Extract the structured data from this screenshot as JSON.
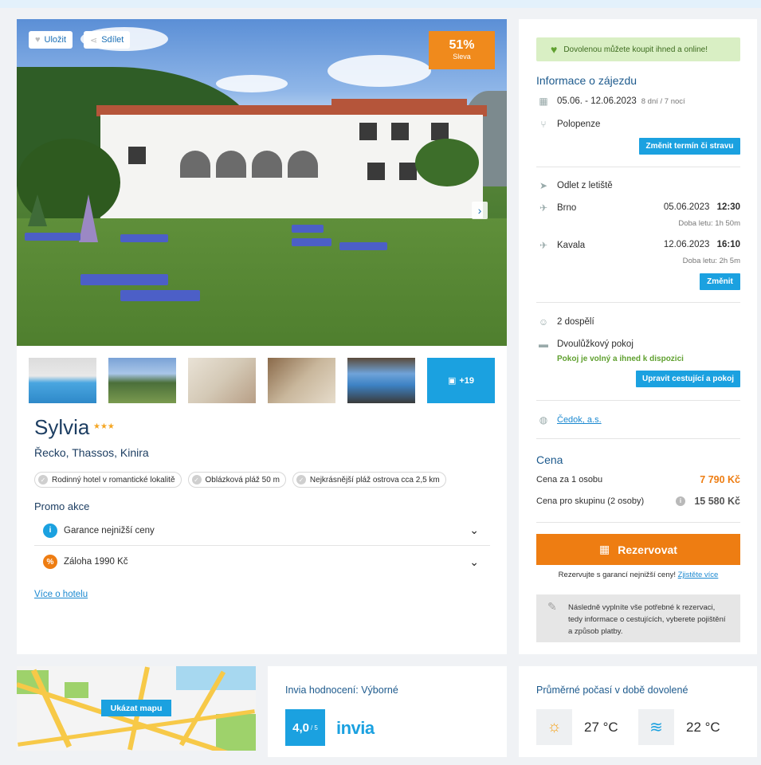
{
  "photo": {
    "save_label": "Uložit",
    "share_label": "Sdílet",
    "discount_pct": "51%",
    "discount_label": "Sleva",
    "more_photos": "+19"
  },
  "hotel": {
    "name": "Sylvia",
    "stars": "★★★",
    "location": "Řecko, Thassos, Kinira",
    "tags": [
      "Rodinný hotel v romantické lokalitě",
      "Oblázková pláž 50 m",
      "Nejkrásnější pláž ostrova cca 2,5 km"
    ],
    "promo_title": "Promo akce",
    "promos": [
      "Garance nejnižší ceny",
      "Záloha 1990 Kč"
    ],
    "more_link": "Více o hotelu"
  },
  "info": {
    "buy_online": "Dovolenou můžete koupit ihned a online!",
    "section_title": "Informace o zájezdu",
    "dates": "05.06. - 12.06.2023",
    "duration": "8 dní / 7 nocí",
    "board": "Polopenze",
    "change_date_btn": "Změnit termín či stravu",
    "departure_title": "Odlet z letiště",
    "out_city": "Brno",
    "out_date": "05.06.2023",
    "out_time": "12:30",
    "out_duration": "Doba letu: 1h 50m",
    "back_city": "Kavala",
    "back_date": "12.06.2023",
    "back_time": "16:10",
    "back_duration": "Doba letu: 2h 5m",
    "change_btn": "Změnit",
    "travellers": "2 dospělí",
    "room": "Dvoulůžkový pokoj",
    "room_status": "Pokoj je volný a ihned k dispozici",
    "edit_btn": "Upravit cestující a pokoj",
    "operator": "Čedok, a.s.",
    "price_title": "Cena",
    "price_person_label": "Cena za 1 osobu",
    "price_person": "7 790 Kč",
    "price_group_label": "Cena pro skupinu (2 osoby)",
    "price_group": "15 580 Kč",
    "reserve_btn": "Rezervovat",
    "guarantee_text": "Rezervujte s garancí nejnižší ceny!",
    "guarantee_link": "Zjistěte více",
    "note": "Následně vyplníte vše potřebné k rezervaci, tedy informace o cestujících, vyberete pojištění a způsob platby."
  },
  "map": {
    "button": "Ukázat mapu"
  },
  "rating": {
    "title": "Invia hodnocení: Výborné",
    "score": "4,0",
    "scale": "/ 5",
    "brand": "invia"
  },
  "weather": {
    "title": "Průměrné počasí v době dovolené",
    "air_temp": "27 °C",
    "water_temp": "22 °C"
  },
  "colors": {
    "accent_blue": "#1ba1e0",
    "orange": "#ee7d12",
    "title_blue": "#1d3e62",
    "green": "#5fa02f"
  }
}
